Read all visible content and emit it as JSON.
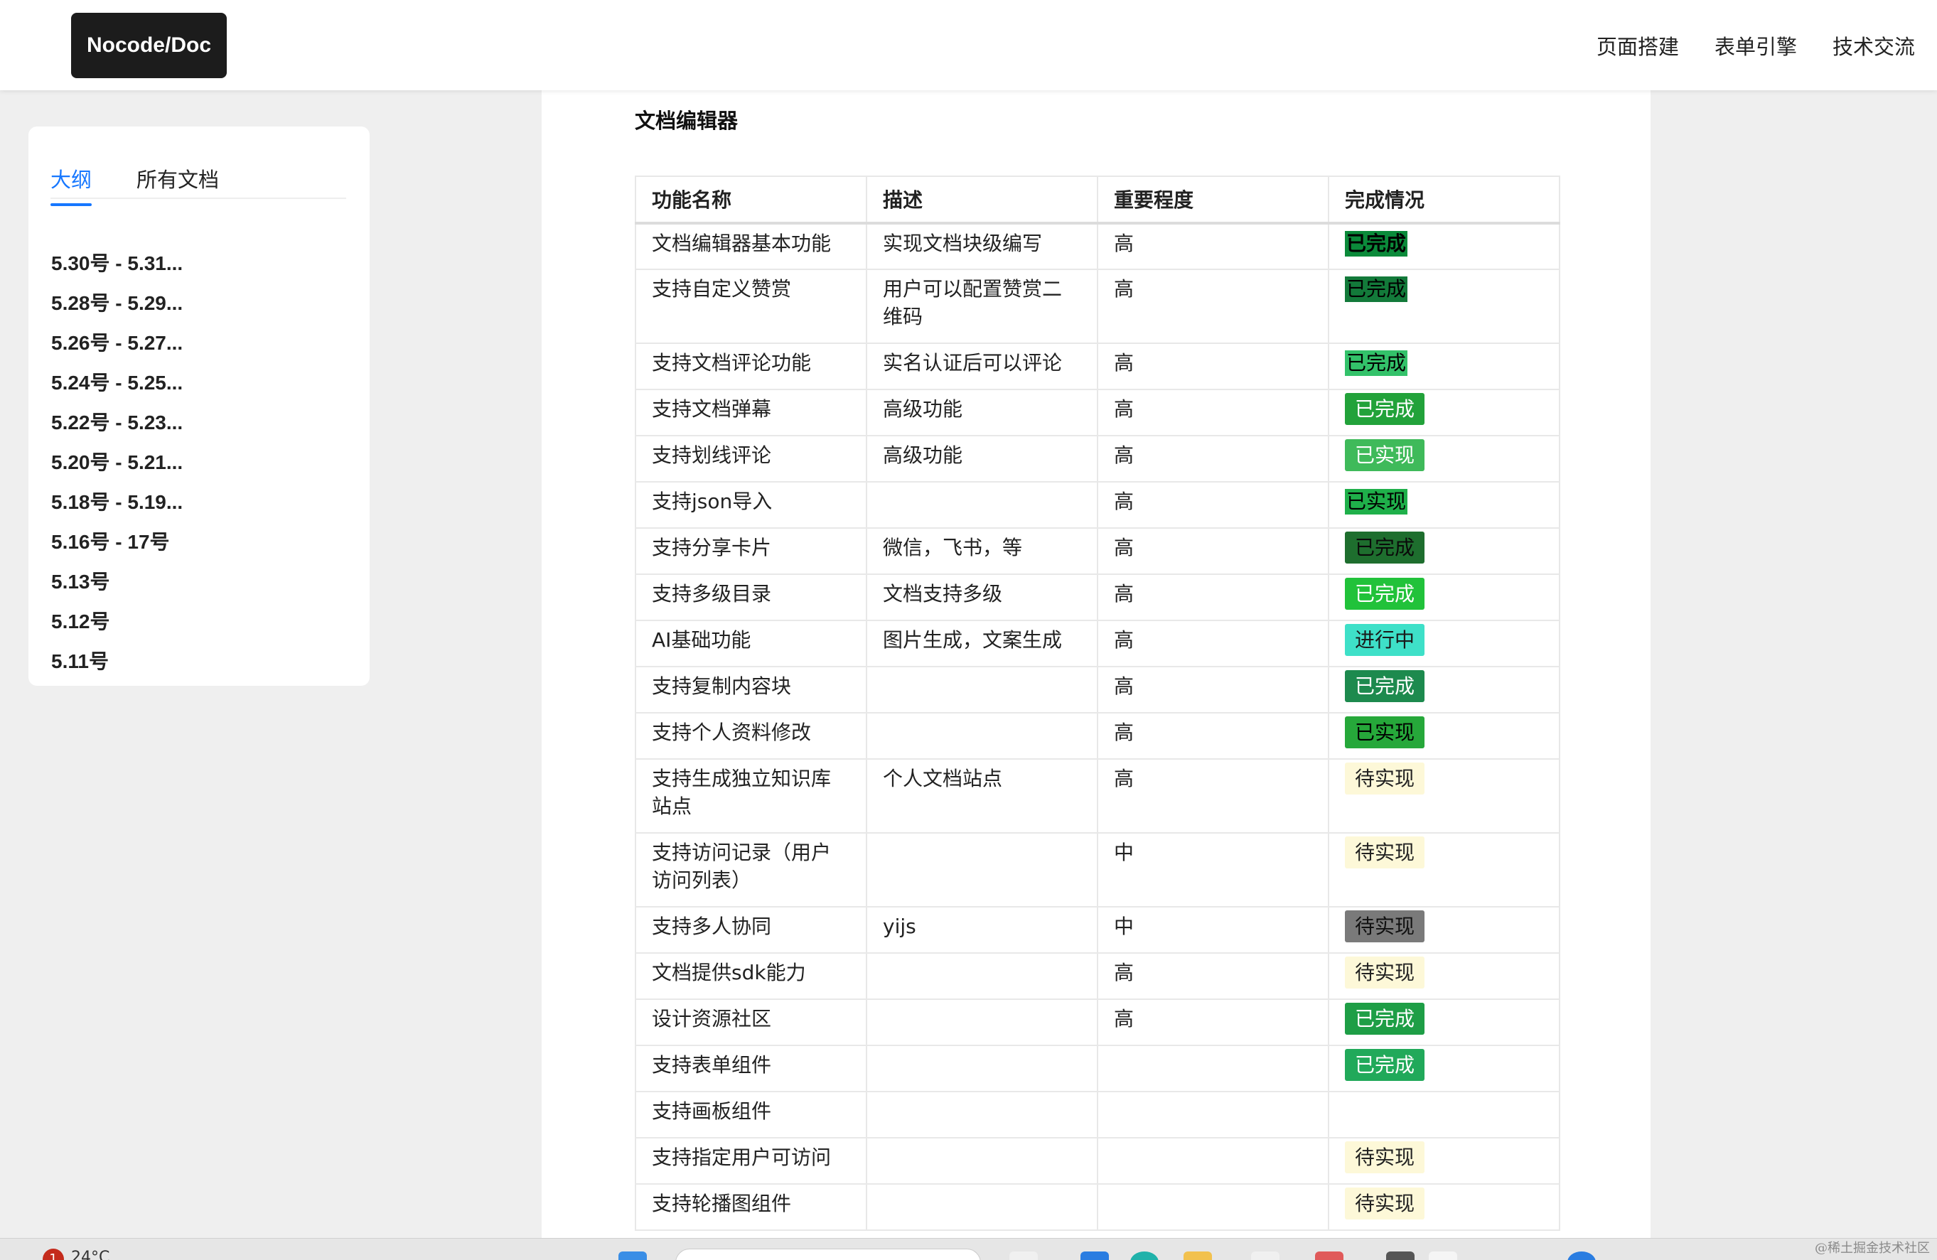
{
  "header": {
    "logo": "Nocode/Doc",
    "nav": [
      "页面搭建",
      "表单引擎",
      "技术交流"
    ]
  },
  "sidebar": {
    "tabs": [
      "大纲",
      "所有文档"
    ],
    "active_tab": "大纲",
    "outline": [
      "5.30号 - 5.31...",
      "5.28号 - 5.29...",
      "5.26号 - 5.27...",
      "5.24号 - 5.25...",
      "5.22号 - 5.23...",
      "5.20号 - 5.21...",
      "5.18号 - 5.19...",
      "5.16号 - 17号",
      "5.13号",
      "5.12号",
      "5.11号"
    ]
  },
  "doc": {
    "title": "文档编辑器",
    "table": {
      "headers": [
        "功能名称",
        "描述",
        "重要程度",
        "完成情况"
      ],
      "rows": [
        {
          "name": "文档编辑器基本功能",
          "desc": "实现文档块级编写",
          "priority": "高",
          "status": "已完成",
          "bg": "#0b8a3a",
          "fg": "#000000",
          "style": "flat",
          "bold": true
        },
        {
          "name": "支持自定义赞赏",
          "desc": "用户可以配置赞赏二维码",
          "priority": "高",
          "status": "已完成",
          "bg": "#137a3a",
          "fg": "#000000",
          "style": "flat",
          "bold": false,
          "tall": true
        },
        {
          "name": "支持文档评论功能",
          "desc": "实名认证后可以评论",
          "priority": "高",
          "status": "已完成",
          "bg": "#33c26a",
          "fg": "#000000",
          "style": "flat",
          "bold": false
        },
        {
          "name": "支持文档弹幕",
          "desc": "高级功能",
          "priority": "高",
          "status": "已完成",
          "bg": "#22a23a",
          "fg": "#ffffff",
          "style": "pill",
          "bold": false
        },
        {
          "name": "支持划线评论",
          "desc": "高级功能",
          "priority": "高",
          "status": "已实现",
          "bg": "#3fba5a",
          "fg": "#ffffff",
          "style": "pill",
          "bold": false
        },
        {
          "name": "支持json导入",
          "desc": "",
          "priority": "高",
          "status": "已实现",
          "bg": "#1fb04a",
          "fg": "#000000",
          "style": "flat",
          "bold": false
        },
        {
          "name": "支持分享卡片",
          "desc": "微信，飞书，等",
          "priority": "高",
          "status": "已完成",
          "bg": "#1e6e2e",
          "fg": "#0a0a0a",
          "style": "pill",
          "bold": false
        },
        {
          "name": "支持多级目录",
          "desc": "文档支持多级",
          "priority": "高",
          "status": "已完成",
          "bg": "#21c23a",
          "fg": "#ffffff",
          "style": "pill",
          "bold": false
        },
        {
          "name": "AI基础功能",
          "desc": "图片生成，文案生成",
          "priority": "高",
          "status": "进行中",
          "bg": "#3ee0c8",
          "fg": "#1a1a1a",
          "style": "pill",
          "bold": false
        },
        {
          "name": "支持复制内容块",
          "desc": "",
          "priority": "高",
          "status": "已完成",
          "bg": "#1d8a4e",
          "fg": "#ffffff",
          "style": "pill",
          "bold": false
        },
        {
          "name": "支持个人资料修改",
          "desc": "",
          "priority": "高",
          "status": "已实现",
          "bg": "#26a83a",
          "fg": "#000000",
          "style": "pill",
          "bold": false
        },
        {
          "name": "支持生成独立知识库站点",
          "desc": "个人文档站点",
          "priority": "高",
          "status": "待实现",
          "bg": "#fdf8d8",
          "fg": "#222222",
          "style": "pill",
          "bold": false,
          "tall": true
        },
        {
          "name": "支持访问记录（用户访问列表）",
          "desc": "",
          "priority": "中",
          "status": "待实现",
          "bg": "#fdf8d8",
          "fg": "#222222",
          "style": "pill",
          "bold": false,
          "tall": true
        },
        {
          "name": "支持多人协同",
          "desc": "yijs",
          "priority": "中",
          "status": "待实现",
          "bg": "#7a7a7a",
          "fg": "#111111",
          "style": "pill",
          "bold": false
        },
        {
          "name": "文档提供sdk能力",
          "desc": "",
          "priority": "高",
          "status": "待实现",
          "bg": "#fdf8d8",
          "fg": "#222222",
          "style": "pill",
          "bold": false
        },
        {
          "name": "设计资源社区",
          "desc": "",
          "priority": "高",
          "status": "已完成",
          "bg": "#1e9e46",
          "fg": "#ffffff",
          "style": "pill",
          "bold": false
        },
        {
          "name": "支持表单组件",
          "desc": "",
          "priority": "",
          "status": "已完成",
          "bg": "#21a95a",
          "fg": "#ffffff",
          "style": "pill",
          "bold": false
        },
        {
          "name": "支持画板组件",
          "desc": "",
          "priority": "",
          "status": "",
          "bg": "",
          "fg": "",
          "style": "none",
          "bold": false
        },
        {
          "name": "支持指定用户可访问",
          "desc": "",
          "priority": "",
          "status": "待实现",
          "bg": "#fdf8d8",
          "fg": "#222222",
          "style": "pill",
          "bold": false
        },
        {
          "name": "支持轮播图组件",
          "desc": "",
          "priority": "",
          "status": "待实现",
          "bg": "#fdf8d8",
          "fg": "#222222",
          "style": "pill",
          "bold": false
        }
      ]
    }
  },
  "taskbar": {
    "notification_count": "1",
    "temperature": "24°C",
    "watermark": "@稀土掘金技术社区"
  }
}
